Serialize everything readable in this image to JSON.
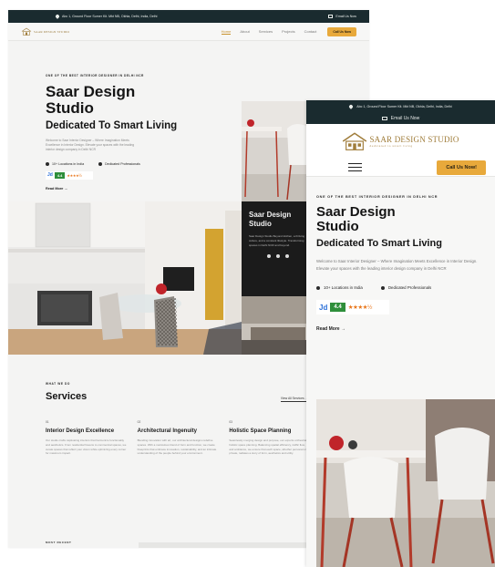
{
  "desktop": {
    "topbar": {
      "address": "Abc 1, Ground Floor Sumer Kit. Mkt NB, Okhla, Delhi, India, Delhi",
      "email": "Email Us Now"
    },
    "logo": {
      "text": "SAAR DESIGN STUDIO"
    },
    "nav": {
      "items": [
        "Home",
        "About",
        "Services",
        "Projects",
        "Contact"
      ],
      "active": "Home",
      "cta": "Call Us Now"
    },
    "hero": {
      "tagline": "ONE OF THE BEST INTERIOR DESIGNER IN DELHI NCR",
      "title_line1": "Saar Design",
      "title_line2": "Studio",
      "subtitle": "Dedicated To Smart Living",
      "description": "Welcome to Saar Interior Designer – Where Imagination Meets Excellence in Interior Design. Elevate your spaces with the leading interior design company in Delhi NCR",
      "stat_locations": "10+ Locations in India",
      "stat_professionals": "Dedicated Professionals",
      "jd_logo": "Jd",
      "rating": "4.4",
      "stars": "★★★★½",
      "read_more": "Read More →"
    },
    "dark_card": {
      "title_line1": "Saar Design",
      "title_line2": "Studio",
      "text": "Saar Design Studio Beyond kitchen, a thriving culture, and a constant lifestyle. Transforming spaces in Delhi NCR and beyond."
    },
    "services": {
      "eyebrow": "WHAT WE DO",
      "title": "Services",
      "view_all": "View All Services →",
      "cards": [
        {
          "num": "01",
          "title": "Interior Design Excellence",
          "desc": "Our studio crafts captivating interiors that harmonize functionality and aesthetics. From residential havens to commercial spaces, we curate spaces that reflect your vision while optimizing every corner for maximum impact."
        },
        {
          "num": "02",
          "title": "Architectural Ingenuity",
          "desc": "Blending innovation with art, our architectural designs redefine spaces. With a meticulous blend of form and function, we create blueprints that embrace innovation, sustainability, and an intimate understanding of the people behind your environment."
        },
        {
          "num": "03",
          "title": "Holistic Space Planning",
          "desc": "Seamlessly merging design and purpose, our experts orchestrate holistic space planning. Balancing spatial efficiency, traffic flow, and ambiance, we ensure that each space, whether personal or private, radiates a story of form, aesthetics and utility."
        }
      ]
    },
    "recent_label": "MOST RECENT"
  },
  "mobile": {
    "topbar_address": "Abc 1, Ground Floor Sumer Kit. Mkt NB, Okhla, Delhi, India, Delhi",
    "topbar_email": "Email Us Now",
    "logo_text": "SAAR DESIGN STUDIO",
    "logo_sub": "dedicated to smart living",
    "cta": "Call Us Now!",
    "hero": {
      "tagline": "ONE OF THE BEST INTERIOR DESIGNER IN DELHI NCR",
      "title_line1": "Saar Design",
      "title_line2": "Studio",
      "subtitle": "Dedicated To Smart Living",
      "description": "Welcome to Saar Interior Designer – Where Imagination Meets Excellence in Interior Design. Elevate your spaces with the leading interior design company in Delhi NCR",
      "stat_locations": "10+ Locations in India",
      "stat_professionals": "Dedicated Professionals",
      "jd_logo": "Jd",
      "rating": "4.4",
      "stars": "★★★★½",
      "read_more": "Read More →"
    }
  },
  "colors": {
    "topbar": "#1a2b2f",
    "accent": "#e8a93b",
    "gold_logo": "#a07d3b",
    "jd_green": "#2f8f3b",
    "dark_card": "#1b1b1b"
  }
}
